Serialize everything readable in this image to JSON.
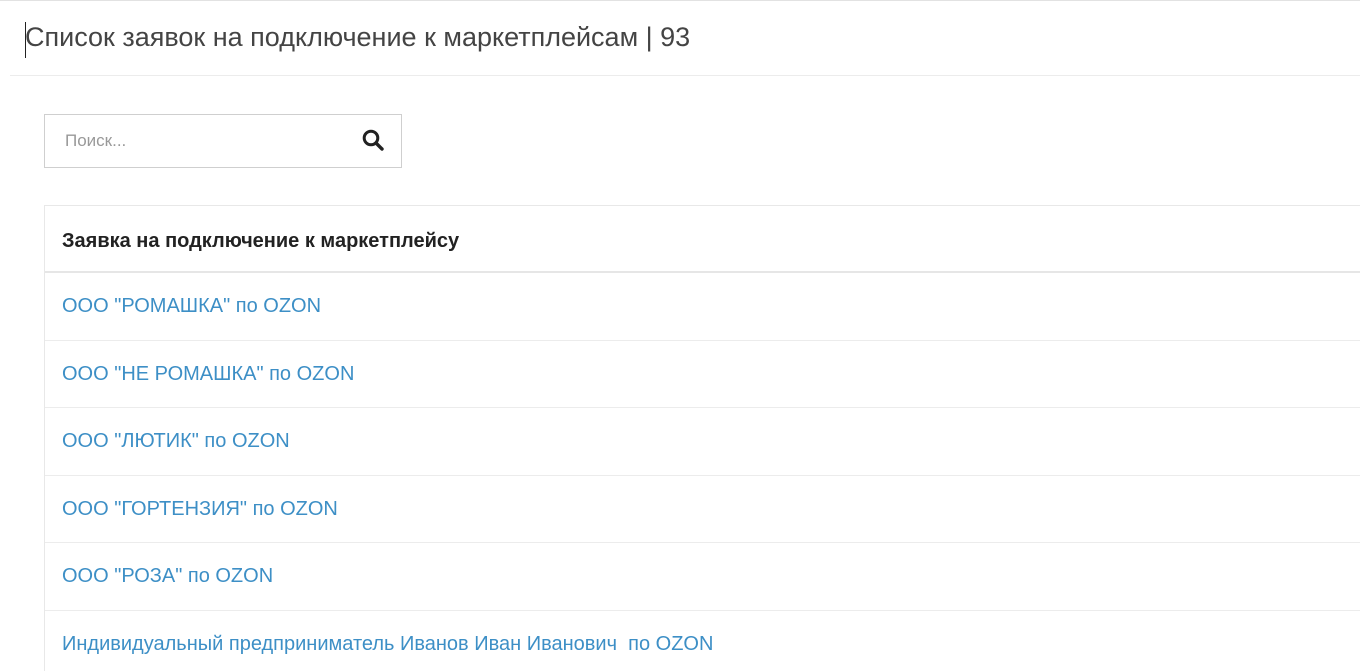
{
  "page": {
    "title": "Список заявок на подключение к маркетплейсам | 93"
  },
  "search": {
    "placeholder": "Поиск...",
    "icon": "search-icon"
  },
  "table": {
    "header": "Заявка на подключение к маркетплейсу",
    "rows": [
      "ООО \"РОМАШКА\" по OZON",
      "ООО \"НЕ РОМАШКА\" по OZON",
      "ООО \"ЛЮТИК\" по OZON",
      "ООО \"ГОРТЕНЗИЯ\" по OZON",
      "ООО \"РОЗА\" по OZON",
      "Индивидуальный предприниматель Иванов Иван Иванович  по OZON"
    ]
  },
  "colors": {
    "link": "#3d8fc6",
    "title": "#444444",
    "header": "#222222"
  }
}
